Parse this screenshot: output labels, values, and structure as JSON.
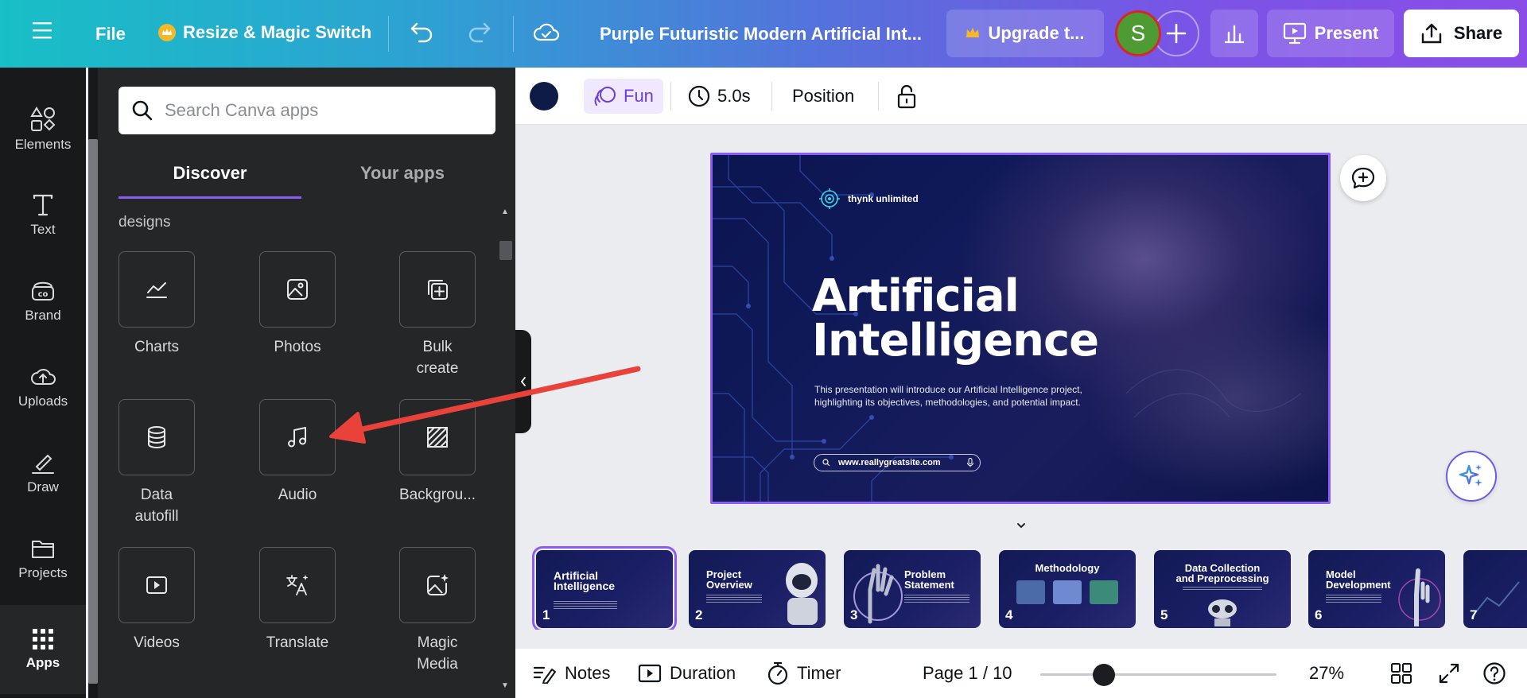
{
  "topbar": {
    "file_label": "File",
    "resize_label": "Resize & Magic Switch",
    "design_title": "Purple Futuristic Modern Artificial Int...",
    "upgrade_label": "Upgrade t...",
    "avatar_initial": "S",
    "present_label": "Present",
    "share_label": "Share"
  },
  "rail": {
    "items": [
      {
        "label": "Elements"
      },
      {
        "label": "Text"
      },
      {
        "label": "Brand"
      },
      {
        "label": "Uploads"
      },
      {
        "label": "Draw"
      },
      {
        "label": "Projects"
      },
      {
        "label": "Apps"
      }
    ]
  },
  "apps_panel": {
    "search_placeholder": "Search Canva apps",
    "tabs": [
      {
        "label": "Discover"
      },
      {
        "label": "Your apps"
      }
    ],
    "partial_text": "designs",
    "tiles": [
      {
        "label": "Charts",
        "icon": "chart-line-icon"
      },
      {
        "label": "Photos",
        "icon": "photo-icon"
      },
      {
        "label": "Bulk\ncreate",
        "icon": "bulk-create-icon"
      },
      {
        "label": "Data\nautofill",
        "icon": "database-icon"
      },
      {
        "label": "Audio",
        "icon": "music-note-icon"
      },
      {
        "label": "Backgrou...",
        "icon": "background-pattern-icon"
      },
      {
        "label": "Videos",
        "icon": "video-play-icon"
      },
      {
        "label": "Translate",
        "icon": "translate-icon"
      },
      {
        "label": "Magic\nMedia",
        "icon": "magic-media-icon"
      }
    ]
  },
  "context_toolbar": {
    "fun_label": "Fun",
    "duration_label": "5.0s",
    "position_label": "Position"
  },
  "slide": {
    "brand": "thynk unlimited",
    "title_line1": "Artificial",
    "title_line2": "Intelligence",
    "description": "This presentation will introduce our Artificial Intelligence project, highlighting its objectives, methodologies, and potential impact.",
    "url": "www.reallygreatsite.com"
  },
  "thumbnails": [
    {
      "num": "1",
      "title": "Artificial\nIntelligence",
      "active": true
    },
    {
      "num": "2",
      "title": "Project\nOverview"
    },
    {
      "num": "3",
      "title": "Problem\nStatement"
    },
    {
      "num": "4",
      "title": "Methodology"
    },
    {
      "num": "5",
      "title": "Data Collection\nand Preprocessing"
    },
    {
      "num": "6",
      "title": "Model\nDevelopment"
    },
    {
      "num": "7",
      "title": ""
    }
  ],
  "bottombar": {
    "notes_label": "Notes",
    "duration_label": "Duration",
    "timer_label": "Timer",
    "page_label": "Page 1 / 10",
    "zoom_label": "27%",
    "zoom_value": 27
  },
  "colors": {
    "accent": "#8b5cf6",
    "arrow": "#e8423a",
    "color_swatch": "#0f1b47"
  }
}
